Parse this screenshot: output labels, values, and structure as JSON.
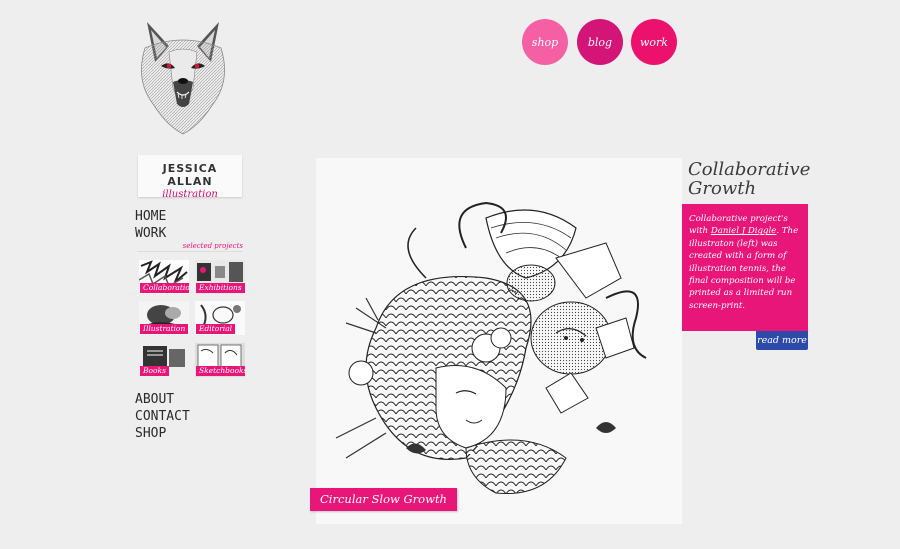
{
  "brand": {
    "name": "JESSICA ALLAN",
    "tagline": "illustration"
  },
  "top_nav": [
    {
      "label": "shop",
      "color": "#f560a5"
    },
    {
      "label": "blog",
      "color": "#d31577"
    },
    {
      "label": "work",
      "color": "#ed116e"
    }
  ],
  "left_nav": {
    "home": "HOME",
    "work": "WORK",
    "selected_projects": "selected projects",
    "about": "ABOUT",
    "contact": "CONTACT",
    "shop": "SHOP"
  },
  "project_thumbs": [
    {
      "label": "Collaboration"
    },
    {
      "label": "Exhibitions"
    },
    {
      "label": "Illustration"
    },
    {
      "label": "Editorial"
    },
    {
      "label": "Books"
    },
    {
      "label": "Sketchbooks"
    }
  ],
  "main": {
    "caption": "Circular Slow Growth"
  },
  "project": {
    "title": "Collaborative Growth",
    "desc_before": "Collaborative project's with ",
    "desc_link": "Daniel J Diggle",
    "desc_after": ". The illustraton (left) was created with a form of illustration tennis, the final composition will be printed as a limited run screen-print.",
    "read_more": "read more"
  },
  "colors": {
    "accent_pink": "#e9167a",
    "read_more_blue": "#2c4aa8",
    "background": "#efeeef"
  }
}
